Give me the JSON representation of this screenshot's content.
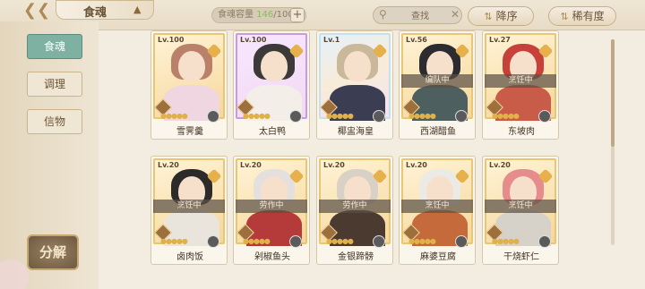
{
  "header": {
    "title": "食魂",
    "capacity_label": "食魂容量",
    "capacity_current": "146",
    "capacity_max": "/1000",
    "search_placeholder": "查找",
    "sort_order_label": "降序",
    "sort_key_label": "稀有度"
  },
  "sidebar": {
    "tabs": [
      {
        "label": "食魂",
        "active": true
      },
      {
        "label": "调理",
        "active": false
      },
      {
        "label": "信物",
        "active": false
      }
    ],
    "decompose_label": "分解"
  },
  "cards": [
    {
      "lv": "Lv.100",
      "name": "雪霁羹",
      "status": "",
      "stars": "●●●●●",
      "frame": "gold",
      "hair": "#b9806a",
      "body": "#efd6e0"
    },
    {
      "lv": "Lv.100",
      "name": "太白鸭",
      "status": "",
      "stars": "●●●●●",
      "frame": "purple",
      "hair": "#3c3a38",
      "body": "#f3efe8"
    },
    {
      "lv": "Lv.1",
      "name": "椰盅海皇",
      "status": "",
      "stars": "●●●●●",
      "frame": "rainbow",
      "hair": "#c9b899",
      "body": "#3b3e52"
    },
    {
      "lv": "Lv.56",
      "name": "西湖醋鱼",
      "status": "编队中",
      "stars": "●●●●●",
      "frame": "gold",
      "hair": "#2c2c30",
      "body": "#4d5f5f"
    },
    {
      "lv": "Lv.27",
      "name": "东坡肉",
      "status": "烹饪中",
      "stars": "●●●●●",
      "frame": "gold",
      "hair": "#c7413a",
      "body": "#c85c48"
    },
    {
      "lv": "Lv.20",
      "name": "卤肉饭",
      "status": "烹饪中",
      "stars": "●●●●●",
      "frame": "gold",
      "hair": "#2d2a2a",
      "body": "#e9e4dc"
    },
    {
      "lv": "Lv.20",
      "name": "剁椒鱼头",
      "status": "劳作中",
      "stars": "●●●●●",
      "frame": "gold",
      "hair": "#e3e0dd",
      "body": "#b53b3b"
    },
    {
      "lv": "Lv.20",
      "name": "金银蹄髈",
      "status": "劳作中",
      "stars": "●●●●●",
      "frame": "gold",
      "hair": "#d9d1c5",
      "body": "#4b3a30"
    },
    {
      "lv": "Lv.20",
      "name": "麻婆豆腐",
      "status": "烹饪中",
      "stars": "●●●●●",
      "frame": "gold",
      "hair": "#eceae5",
      "body": "#c46a3b"
    },
    {
      "lv": "Lv.20",
      "name": "干烧虾仁",
      "status": "烹饪中",
      "stars": "●●●●●",
      "frame": "gold",
      "hair": "#e68c8c",
      "body": "#d7d2c9"
    }
  ],
  "colors": {
    "accent_tab": "#7fb1a3",
    "gold_frame": "#e8c774",
    "star": "#e0b149",
    "capacity_current": "#8dbb5a"
  },
  "icons": {
    "back": "back-chevron-icon",
    "title_crown": "crown-icon",
    "search": "search-icon",
    "clear": "clear-icon",
    "sort_order": "sort-order-icon",
    "sort_key": "sort-filter-icon"
  }
}
